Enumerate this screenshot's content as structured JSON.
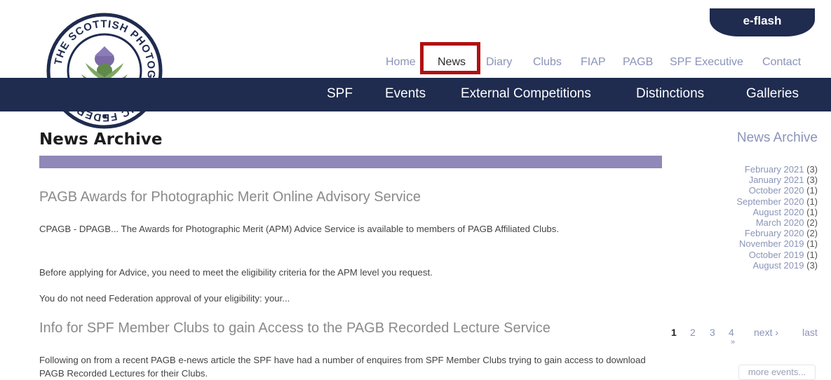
{
  "eflash": {
    "label": "e-flash"
  },
  "top_nav": [
    {
      "label": "Home"
    },
    {
      "label": "News"
    },
    {
      "label": "Diary"
    },
    {
      "label": "Clubs"
    },
    {
      "label": "FIAP"
    },
    {
      "label": "PAGB"
    },
    {
      "label": "SPF Executive"
    },
    {
      "label": "Contact"
    }
  ],
  "main_nav": [
    {
      "label": "SPF"
    },
    {
      "label": "Events"
    },
    {
      "label": "External Competitions"
    },
    {
      "label": "Distinctions"
    },
    {
      "label": "Galleries"
    }
  ],
  "logo": {
    "text": "THE SCOTTISH PHOTOGRAPHIC FEDERATION"
  },
  "page_title": "News Archive",
  "articles": [
    {
      "title": "PAGB Awards for Photographic Merit Online Advisory Service",
      "paragraphs": [
        "CPAGB - DPAGB... The Awards for Photographic Merit (APM) Advice Service is available to members of PAGB Affiliated Clubs.",
        "Before applying for Advice, you need to meet the eligibility criteria for the APM level you request.",
        "You do not need Federation approval of your eligibility: your..."
      ]
    },
    {
      "title": "Info for SPF Member Clubs to gain Access to the PAGB Recorded Lecture Service",
      "paragraphs": [
        "Following on from a recent PAGB e-news article the SPF have had a number of enquires from SPF Member Clubs trying to gain access to download PAGB Recorded Lectures for their Clubs."
      ]
    }
  ],
  "sidebar": {
    "title": "News Archive",
    "archive": [
      {
        "month": "February 2021",
        "count": "(3)"
      },
      {
        "month": "January 2021",
        "count": "(3)"
      },
      {
        "month": "October 2020",
        "count": "(1)"
      },
      {
        "month": "September 2020",
        "count": "(1)"
      },
      {
        "month": "August 2020",
        "count": "(1)"
      },
      {
        "month": "March 2020",
        "count": "(2)"
      },
      {
        "month": "February 2020",
        "count": "(2)"
      },
      {
        "month": "November 2019",
        "count": "(1)"
      },
      {
        "month": "October 2019",
        "count": "(1)"
      },
      {
        "month": "August 2019",
        "count": "(3)"
      }
    ],
    "pager": {
      "pages": [
        "1",
        "2",
        "3",
        "4"
      ],
      "next": "next ›",
      "last": "last",
      "extra": "»"
    },
    "more_events": "more events..."
  },
  "colors": {
    "navy": "#1f2b4f",
    "purple_bar": "#8f88b9",
    "highlight": "#b00f12",
    "nav_link": "#8a94b8"
  }
}
